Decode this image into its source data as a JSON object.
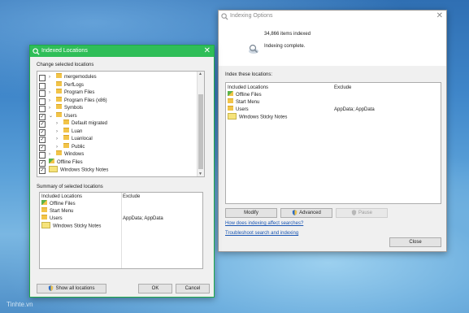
{
  "watermark": "Tinhte.vn",
  "indexing_options": {
    "title": "Indexing Options",
    "items_indexed": "34,866 items indexed",
    "status": "Indexing complete.",
    "index_these_label": "Index these locations:",
    "columns": [
      "Included Locations",
      "Exclude"
    ],
    "rows": [
      {
        "icon": "offline-files-icon",
        "name": "Offline Files",
        "exclude": ""
      },
      {
        "icon": "folder-icon",
        "name": "Start Menu",
        "exclude": ""
      },
      {
        "icon": "folder-icon",
        "name": "Users",
        "exclude": "AppData; AppData"
      },
      {
        "icon": "sticky-notes-icon",
        "name": "Windows Sticky Notes",
        "exclude": ""
      }
    ],
    "buttons": {
      "modify": "Modify",
      "advanced": "Advanced",
      "pause": "Pause",
      "close": "Close"
    },
    "links": {
      "how": "How does indexing affect searches?",
      "troubleshoot": "Troubleshoot search and indexing"
    }
  },
  "indexed_locations": {
    "title": "Indexed Locations",
    "change_label": "Change selected locations",
    "tree": [
      {
        "label": "mergemodules",
        "checked": false,
        "expand": ">",
        "indent": 0,
        "icon": "folder"
      },
      {
        "label": "PerfLogs",
        "checked": false,
        "expand": "",
        "indent": 0,
        "icon": "folder"
      },
      {
        "label": "Program Files",
        "checked": false,
        "expand": ">",
        "indent": 0,
        "icon": "folder"
      },
      {
        "label": "Program Files (x86)",
        "checked": false,
        "expand": ">",
        "indent": 0,
        "icon": "folder"
      },
      {
        "label": "Symbols",
        "checked": false,
        "expand": ">",
        "indent": 0,
        "icon": "folder"
      },
      {
        "label": "Users",
        "checked": true,
        "expand": "v",
        "indent": 0,
        "icon": "folder"
      },
      {
        "label": "Default migrated",
        "checked": true,
        "expand": ">",
        "indent": 1,
        "icon": "folder"
      },
      {
        "label": "Luan",
        "checked": true,
        "expand": ">",
        "indent": 1,
        "icon": "folder"
      },
      {
        "label": "Luanlocal",
        "checked": true,
        "expand": ">",
        "indent": 1,
        "icon": "folder"
      },
      {
        "label": "Public",
        "checked": true,
        "expand": ">",
        "indent": 1,
        "icon": "folder"
      },
      {
        "label": "Windows",
        "checked": false,
        "expand": ">",
        "indent": 0,
        "icon": "folder"
      },
      {
        "label": "Offline Files",
        "checked": true,
        "expand": "",
        "indent": -1,
        "icon": "offline"
      },
      {
        "label": "Windows Sticky Notes",
        "checked": true,
        "expand": "",
        "indent": -1,
        "icon": "sticky"
      }
    ],
    "summary_label": "Summary of selected locations",
    "columns": [
      "Included Locations",
      "Exclude"
    ],
    "summary_rows": [
      {
        "icon": "offline",
        "name": "Offline Files",
        "exclude": ""
      },
      {
        "icon": "folder",
        "name": "Start Menu",
        "exclude": ""
      },
      {
        "icon": "folder",
        "name": "Users",
        "exclude": "AppData; AppData"
      },
      {
        "icon": "sticky",
        "name": "Windows Sticky Notes",
        "exclude": ""
      }
    ],
    "buttons": {
      "show_all": "Show all locations",
      "ok": "OK",
      "cancel": "Cancel"
    }
  },
  "colors": {
    "green_title": "#2fbe58",
    "link_blue": "#1a56b3"
  }
}
